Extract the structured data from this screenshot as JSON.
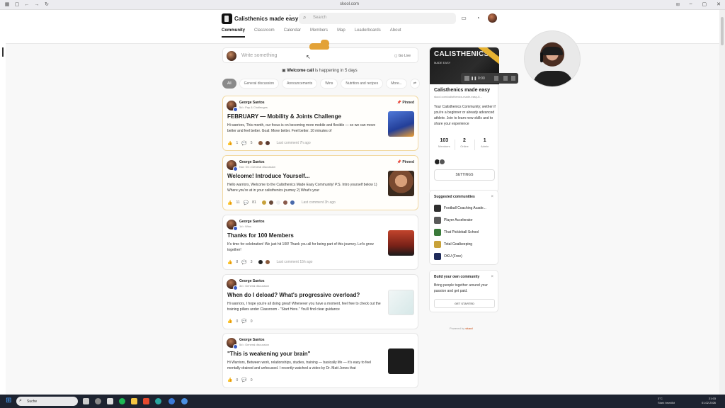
{
  "browser": {
    "url": "skool.com"
  },
  "header": {
    "community_name": "Calisthenics made easy",
    "search_placeholder": "Search",
    "tabs": [
      "Community",
      "Classroom",
      "Calendar",
      "Members",
      "Map",
      "Leaderboards",
      "About"
    ]
  },
  "composer": {
    "placeholder": "Write something",
    "live_label": "Go Live"
  },
  "welcome_banner": {
    "bold": "Welcome call",
    "rest": " is happening in 5 days"
  },
  "filters": [
    "All",
    "General discussion",
    "Announcements",
    "Wins",
    "Nutrition and recipes",
    "More..."
  ],
  "posts": [
    {
      "author": "George Santos",
      "meta": "5d • Pay & Challenges",
      "pinned": "Pinned",
      "title": "FEBRUARY — Mobility & Joints Challenge",
      "excerpt": "Hi warriors, This month, our focus is on becoming more mobile and flexible — so we can move better and feel better. Goal: Move better. Feel better. 10 minutes of",
      "likes": "1",
      "comments": "5",
      "last": "Last comment 7h ago",
      "thumb_color": "#3a58b8"
    },
    {
      "author": "George Santos",
      "meta": "Nov '25 • General discussion",
      "pinned": "Pinned",
      "title": "Welcome! Introduce Yourself...",
      "excerpt": "Hello warriors, Welcome to the Calisthenics Made Easy Community! P.S. Intro yourself below 1) Where you're at in your calisthenics journey 2) What's your",
      "likes": "11",
      "comments": "81",
      "last": "Last comment 3h ago",
      "thumb_color": "#8a5a3c"
    },
    {
      "author": "George Santos",
      "meta": "1d • Wins",
      "pinned": "",
      "title": "Thanks for 100 Members",
      "excerpt": "It's time for celebration! We just hit 100! Thank you all for being part of this journey. Let's grow together!",
      "likes": "8",
      "comments": "3",
      "last": "Last comment 15h ago",
      "thumb_color": "#b8402a"
    },
    {
      "author": "George Santos",
      "meta": "3d • General discussion",
      "pinned": "",
      "title": "When do I deload? What's progressive overload?",
      "excerpt": "Hi warriors, I hope you're all doing great! Whenever you have a moment, feel free to check out the training pillars under Classroom - \"Start Here.\" You'll find clear guidance",
      "likes": "0",
      "comments": "0",
      "last": "",
      "thumb_color": "#dfe9ea"
    },
    {
      "author": "George Santos",
      "meta": "5d • General discussion",
      "pinned": "",
      "title": "\"This is weakening your brain\"",
      "excerpt": "Hi Warriors, Between work, relationships, studies, training — basically life — it's easy to feel mentally drained and unfocused. I recently watched a video by Dr. Matt Jones that",
      "likes": "0",
      "comments": "0",
      "last": "",
      "thumb_color": "#1c1c1c"
    }
  ],
  "sidebar": {
    "cover_text": "CALISTHENICS",
    "cover_sub": "MADE EASY",
    "title": "Calisthenics made easy",
    "url": "skool.com/calisthenics-made-easy-6...",
    "description": "Your Calisthenics Community; wether if you're a beginner or already advanced athlete. Join to learn new skills and to share your experience",
    "stats": [
      {
        "n": "103",
        "l": "Members"
      },
      {
        "n": "2",
        "l": "Online"
      },
      {
        "n": "1",
        "l": "Admin"
      }
    ],
    "settings_label": "SETTINGS",
    "suggested_title": "Suggested communities",
    "suggested": [
      {
        "name": "Football Coaching Acade...",
        "color": "#2f2f2f"
      },
      {
        "name": "Player Accelerator",
        "color": "#5a5a5a"
      },
      {
        "name": "That Pickleball School",
        "color": "#3a7a3a"
      },
      {
        "name": "Total Goalkeeping",
        "color": "#c8a23a"
      },
      {
        "name": "OKU (Free)",
        "color": "#1f2b5a"
      }
    ],
    "build_title": "Build your own community",
    "build_desc": "Bring people together around your passion and get paid.",
    "build_button": "GET STARTED",
    "powered_prefix": "Powered by",
    "powered_brand": "skool"
  },
  "media_bar": {
    "time": "0:00"
  },
  "taskbar": {
    "search_label": "Suche",
    "weather_temp": "3°C",
    "weather_desc": "Stark bewölkt",
    "time": "21:03",
    "date": "01.02.2026"
  }
}
